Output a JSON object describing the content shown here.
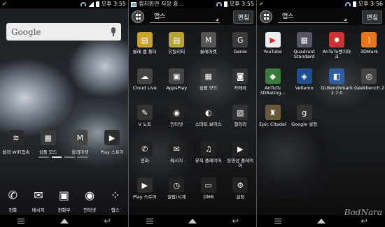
{
  "panel1": {
    "status": {
      "time": "오후 3:55"
    },
    "search": {
      "label": "Google"
    },
    "shortcuts": [
      {
        "label": "올레 WiFi접속",
        "icon": "wifi-olleh-icon",
        "color": "#2a2a2a",
        "glyph": "≋"
      },
      {
        "label": "심플 모드",
        "icon": "simple-mode-icon",
        "color": "#3a3a3a",
        "glyph": "▦"
      },
      {
        "label": "올레마켓",
        "icon": "olleh-market-icon",
        "color": "#444",
        "glyph": "M"
      },
      {
        "label": "Play 스토어",
        "icon": "play-store-icon",
        "color": "#2d2d2d",
        "glyph": "▶"
      }
    ],
    "dock": [
      {
        "label": "전화",
        "icon": "phone-icon",
        "glyph": "✆"
      },
      {
        "label": "메시지",
        "icon": "message-icon",
        "glyph": "✉"
      },
      {
        "label": "전화부",
        "icon": "contacts-icon",
        "glyph": "▣"
      },
      {
        "label": "인터넷",
        "icon": "internet-globe-icon",
        "glyph": "◉"
      },
      {
        "label": "앱스",
        "icon": "apps-grid-icon",
        "glyph": "⁘"
      }
    ]
  },
  "panel2": {
    "status": {
      "text": "캡처화면 저장 중...",
      "time": "오후 3:55"
    },
    "header": {
      "tab": "앱스",
      "edit": "편집"
    },
    "apps": [
      {
        "label": "올레 앱 폴더",
        "icon": "olleh-folder-icon",
        "color": "#c9a12a",
        "glyph": "▤"
      },
      {
        "label": "유틸리티",
        "icon": "utility-folder-icon",
        "color": "#b8a233",
        "glyph": "▤"
      },
      {
        "label": "올레마켓",
        "icon": "olleh-market-icon",
        "color": "#555",
        "glyph": "M"
      },
      {
        "label": "Genie",
        "icon": "genie-icon",
        "color": "#3b3b3b",
        "glyph": "G"
      },
      {
        "label": "Cloud Live",
        "icon": "cloud-live-icon",
        "color": "#444",
        "glyph": "☁"
      },
      {
        "label": "AppsPlay",
        "icon": "appsplay-icon",
        "color": "#444",
        "glyph": "▣"
      },
      {
        "label": "심플 모드",
        "icon": "simple-mode-icon",
        "color": "#3a3a3a",
        "glyph": "▦"
      },
      {
        "label": "카메라",
        "icon": "camera-icon",
        "color": "#333",
        "glyph": "◙"
      },
      {
        "label": "V 노트",
        "icon": "v-note-icon",
        "color": "#333",
        "glyph": "✎"
      },
      {
        "label": "인터넷",
        "icon": "internet-globe-icon",
        "color": "#222",
        "glyph": "◉"
      },
      {
        "label": "스마트 보이스",
        "icon": "smart-voice-icon",
        "color": "#222",
        "glyph": "◐"
      },
      {
        "label": "갤러리",
        "icon": "gallery-icon",
        "color": "#333",
        "glyph": "▧"
      },
      {
        "label": "전화",
        "icon": "phone-icon",
        "color": "#222",
        "glyph": "✆"
      },
      {
        "label": "메시지",
        "icon": "message-icon",
        "color": "#222",
        "glyph": "✉"
      },
      {
        "label": "뮤직 플레이어",
        "icon": "music-player-icon",
        "color": "#222",
        "glyph": "♫"
      },
      {
        "label": "동영상 플레이어",
        "icon": "video-player-icon",
        "color": "#222",
        "glyph": "▶"
      },
      {
        "label": "Play 스토어",
        "icon": "play-store-icon",
        "color": "#2d2d2d",
        "glyph": "▶"
      },
      {
        "label": "알람/시계",
        "icon": "alarm-clock-icon",
        "color": "#222",
        "glyph": "◷"
      },
      {
        "label": "DMB",
        "icon": "dmb-tv-icon",
        "color": "#222",
        "glyph": "▭"
      },
      {
        "label": "설정",
        "icon": "settings-gear-icon",
        "color": "#222",
        "glyph": "⚙"
      }
    ]
  },
  "panel3": {
    "status": {
      "time": "오후 3:56"
    },
    "header": {
      "tab": "앱스",
      "edit": "편집"
    },
    "apps": [
      {
        "label": "YouTube",
        "icon": "youtube-icon",
        "color": "#eee",
        "glyph": "▶",
        "fg": "#d22"
      },
      {
        "label": "Quadrant Standard",
        "icon": "quadrant-icon",
        "color": "#556",
        "glyph": "▦"
      },
      {
        "label": "AnTuTu벤치마크",
        "icon": "antutu-icon",
        "color": "#c33",
        "glyph": "✹"
      },
      {
        "label": "3DMark",
        "icon": "3dmark-icon",
        "color": "#e8751a",
        "glyph": "⟩"
      },
      {
        "label": "AnTuTu 3DRating...",
        "icon": "antutu-3d-icon",
        "color": "#3a7a3a",
        "glyph": "◆"
      },
      {
        "label": "Vellamo",
        "icon": "vellamo-icon",
        "color": "#1f4f8f",
        "glyph": "◈"
      },
      {
        "label": "GLBenchmark 2.7.0",
        "icon": "glbenchmark-icon",
        "color": "#2d5fa0",
        "glyph": "◧"
      },
      {
        "label": "Geekbench 2",
        "icon": "geekbench-icon",
        "color": "#444",
        "glyph": "◎"
      },
      {
        "label": "Epic Citadel",
        "icon": "epic-citadel-icon",
        "color": "#6a5a3a",
        "glyph": "♜"
      },
      {
        "label": "Google 설정",
        "icon": "google-settings-icon",
        "color": "#333",
        "glyph": "g"
      }
    ],
    "watermark": "BodNara"
  }
}
